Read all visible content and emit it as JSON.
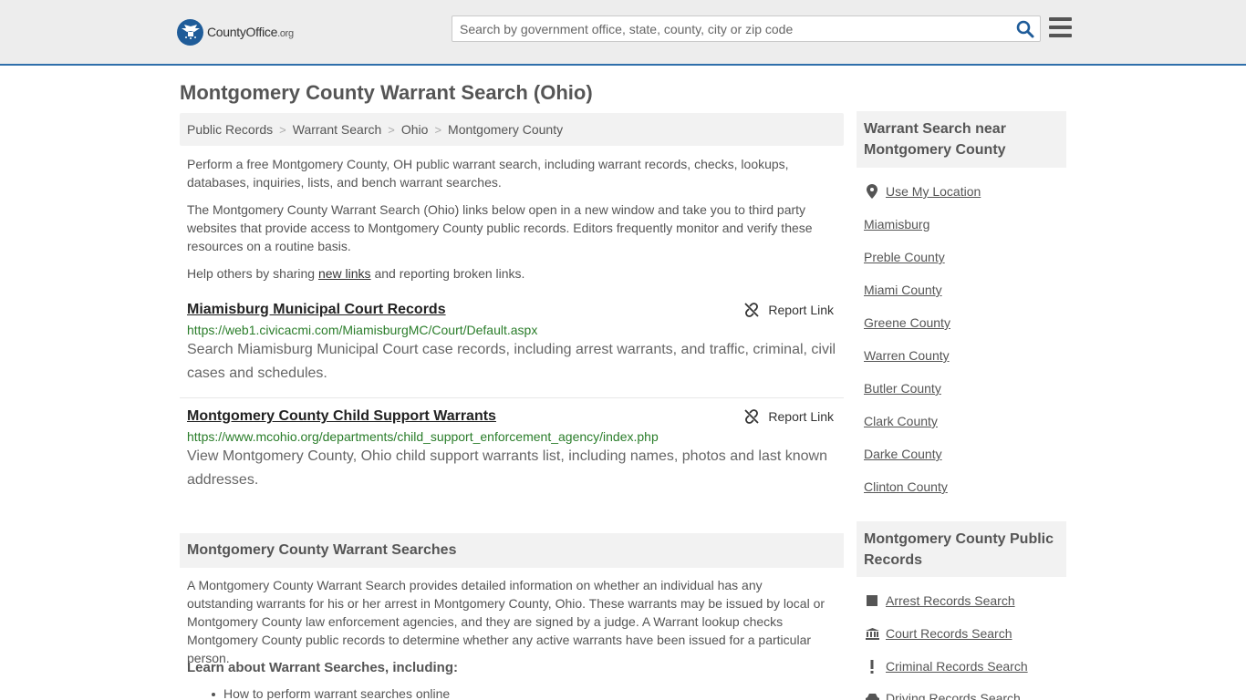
{
  "header": {
    "logo_main": "CountyOffice",
    "logo_suffix": ".org",
    "search_placeholder": "Search by government office, state, county, city or zip code"
  },
  "page_title": "Montgomery County Warrant Search (Ohio)",
  "breadcrumb": [
    "Public Records",
    "Warrant Search",
    "Ohio",
    "Montgomery County"
  ],
  "intro": {
    "p1": "Perform a free Montgomery County, OH public warrant search, including warrant records, checks, lookups, databases, inquiries, lists, and bench warrant searches.",
    "p2": "The Montgomery County Warrant Search (Ohio) links below open in a new window and take you to third party websites that provide access to Montgomery County public records. Editors frequently monitor and verify these resources on a routine basis.",
    "p3_before": "Help others by sharing ",
    "p3_link": "new links",
    "p3_after": " and reporting broken links."
  },
  "results": [
    {
      "title": "Miamisburg Municipal Court Records",
      "url": "https://web1.civicacmi.com/MiamisburgMC/Court/Default.aspx",
      "description": "Search Miamisburg Municipal Court case records, including arrest warrants, and traffic, criminal, civil cases and schedules.",
      "report_label": "Report Link"
    },
    {
      "title": "Montgomery County Child Support Warrants",
      "url": "https://www.mcohio.org/departments/child_support_enforcement_agency/index.php",
      "description": "View Montgomery County, Ohio child support warrants list, including names, photos and last known addresses.",
      "report_label": "Report Link"
    }
  ],
  "section": {
    "heading": "Montgomery County Warrant Searches",
    "body": "A Montgomery County Warrant Search provides detailed information on whether an individual has any outstanding warrants for his or her arrest in Montgomery County, Ohio. These warrants may be issued by local or Montgomery County law enforcement agencies, and they are signed by a judge. A Warrant lookup checks Montgomery County public records to determine whether any active warrants have been issued for a particular person.",
    "learn_heading": "Learn about Warrant Searches, including:",
    "bullets": [
      "How to perform warrant searches online"
    ]
  },
  "sidebar": {
    "near_heading": "Warrant Search near Montgomery County",
    "use_location": "Use My Location",
    "near_links": [
      "Miamisburg",
      "Preble County",
      "Miami County",
      "Greene County",
      "Warren County",
      "Butler County",
      "Clark County",
      "Darke County",
      "Clinton County"
    ],
    "records_heading": "Montgomery County Public Records",
    "records_links": [
      {
        "label": "Arrest Records Search",
        "icon": "square-icon"
      },
      {
        "label": "Court Records Search",
        "icon": "courthouse-icon"
      },
      {
        "label": "Criminal Records Search",
        "icon": "exclamation-icon"
      },
      {
        "label": "Driving Records Search",
        "icon": "car-icon"
      }
    ]
  },
  "colors": {
    "header_bg": "#ededed",
    "header_border": "#2f6fab",
    "logo_blue": "#1f5c99",
    "search_icon": "#1f5c99",
    "url_green": "#2a7d2a",
    "panel_bg": "#f2f2f2"
  }
}
